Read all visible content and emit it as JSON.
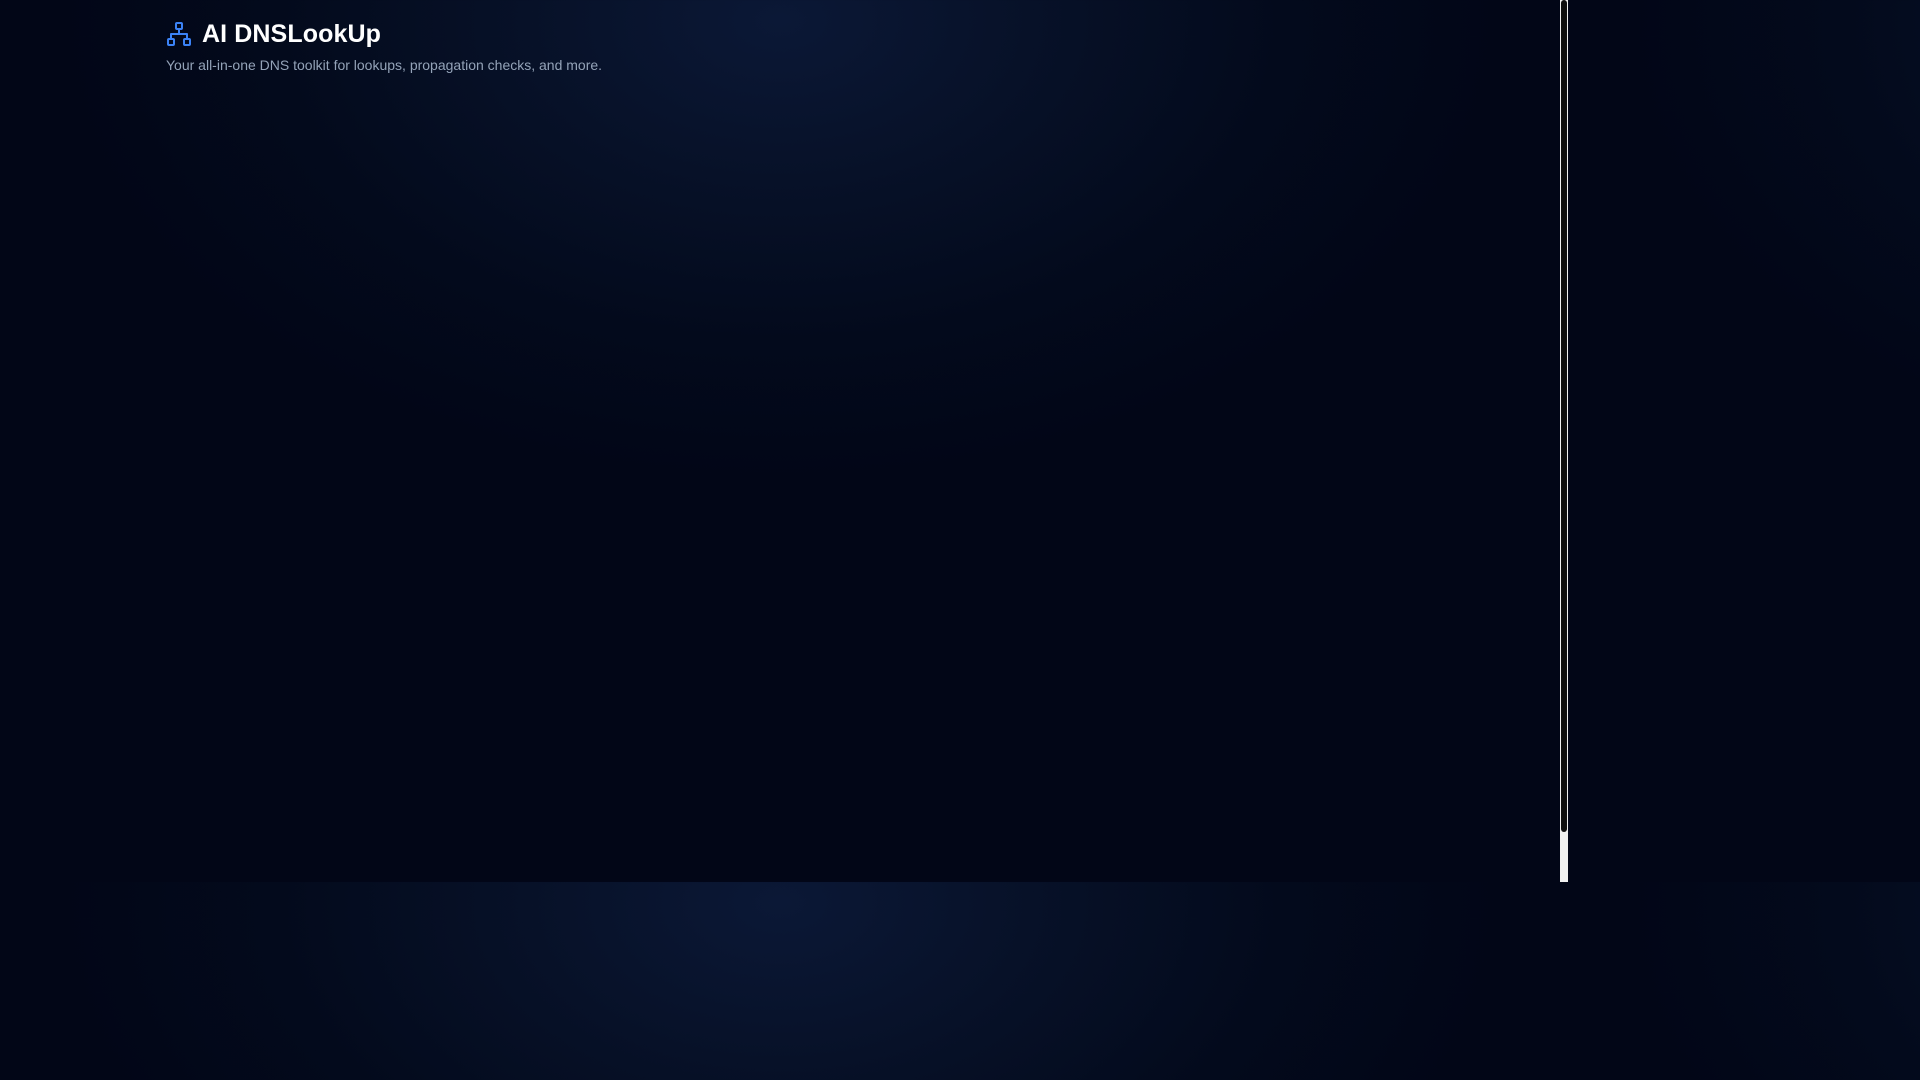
{
  "header": {
    "logo_icon": "sitemap-network-icon",
    "title": "AI DNSLookUp",
    "tagline": "Your all-in-one DNS toolkit for lookups, propagation checks, and more."
  },
  "colors": {
    "background": "#020617",
    "accent_blue": "#3b82f6",
    "title_text": "#ffffff",
    "tagline_text": "#94a3b8"
  }
}
